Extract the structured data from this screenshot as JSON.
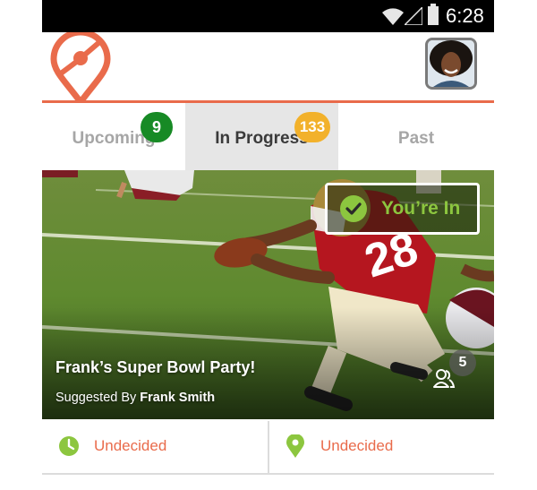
{
  "status_bar": {
    "time": "6:28"
  },
  "header": {
    "logo": "location-pin-logo",
    "avatar": "user-avatar"
  },
  "tabs": [
    {
      "label": "Upcoming",
      "badge": "9",
      "badge_color": "#178a25",
      "active": false
    },
    {
      "label": "In Progress",
      "badge": "133",
      "badge_color": "#f2b12b",
      "active": true
    },
    {
      "label": "Past",
      "active": false
    }
  ],
  "event": {
    "status_label": "You’re In",
    "title": "Frank’s Super Bowl Party!",
    "suggested_prefix": "Suggested By",
    "suggested_by": "Frank Smith",
    "attendee_count": "5"
  },
  "info": {
    "time_label": "Undecided",
    "place_label": "Undecided"
  },
  "colors": {
    "accent": "#e96b4b",
    "check_green": "#8cc63f",
    "badge_green": "#178a25",
    "badge_yellow": "#f2b12b"
  }
}
